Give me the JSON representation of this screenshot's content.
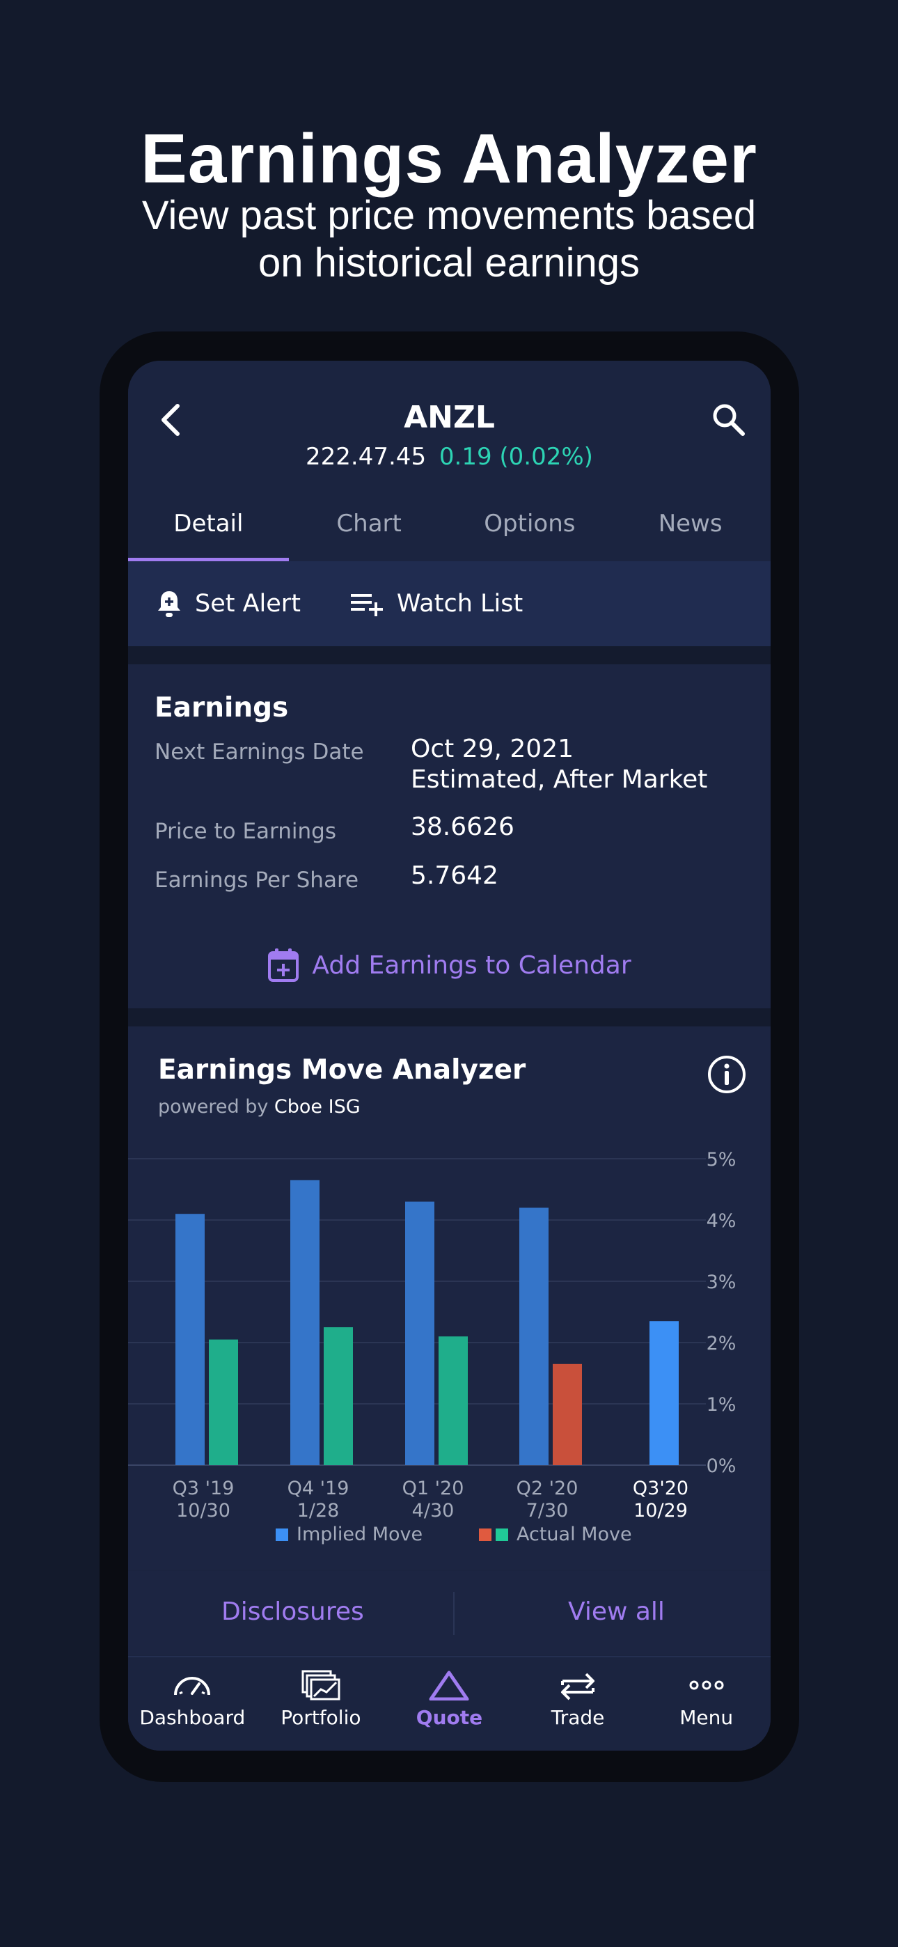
{
  "hero": {
    "title": "Earnings Analyzer",
    "subtitle_line1": "View past price movements based",
    "subtitle_line2": "on historical earnings"
  },
  "header": {
    "ticker": "ANZL",
    "price": "222.47.45",
    "change": "0.19 (0.02%)",
    "back_icon": "chevron-left-icon",
    "search_icon": "search-icon"
  },
  "tabs": [
    {
      "label": "Detail",
      "active": true
    },
    {
      "label": "Chart",
      "active": false
    },
    {
      "label": "Options",
      "active": false
    },
    {
      "label": "News",
      "active": false
    }
  ],
  "actions": {
    "set_alert": "Set Alert",
    "watch_list": "Watch List"
  },
  "earnings": {
    "title": "Earnings",
    "rows": [
      {
        "label": "Next Earnings Date",
        "value": "Oct 29, 2021",
        "value2": "Estimated, After Market"
      },
      {
        "label": "Price to Earnings",
        "value": "38.6626"
      },
      {
        "label": "Earnings Per Share",
        "value": "5.7642"
      }
    ],
    "calendar_link": "Add Earnings to Calendar"
  },
  "analyzer": {
    "title": "Earnings Move Analyzer",
    "powered_prefix": "powered by",
    "powered_by": "Cboe ISG"
  },
  "chart_data": {
    "type": "bar",
    "categories": [
      "Q3 '19\n10/30",
      "Q4 '19\n1/28",
      "Q1 '20\n4/30",
      "Q2 '20\n7/30",
      "Q3'20\n10/29"
    ],
    "category_line1": [
      "Q3 '19",
      "Q4 '19",
      "Q1 '20",
      "Q2 '20",
      "Q3'20"
    ],
    "category_line2": [
      "10/30",
      "1/28",
      "4/30",
      "7/30",
      "10/29"
    ],
    "series": [
      {
        "name": "Implied Move",
        "values": [
          4.1,
          4.65,
          4.3,
          4.2,
          2.35
        ]
      },
      {
        "name": "Actual Move",
        "values": [
          2.05,
          2.25,
          2.1,
          1.65,
          null
        ],
        "negative": [
          false,
          false,
          false,
          true,
          false
        ]
      }
    ],
    "yticks": [
      "5%",
      "4%",
      "3%",
      "2%",
      "1%",
      "0%"
    ],
    "ylim": [
      0,
      5
    ],
    "grid": true,
    "legend_position": "bottom",
    "colors": {
      "implied": "#3575c9",
      "implied_upcoming": "#3c90f5",
      "actual_up": "#1fae8b",
      "actual_down": "#c9503b"
    },
    "legend": {
      "implied": "Implied Move",
      "actual": "Actual Move"
    }
  },
  "footer": {
    "disclosures": "Disclosures",
    "view_all": "View all"
  },
  "tabbar": [
    {
      "label": "Dashboard",
      "icon": "speedometer-icon",
      "active": false
    },
    {
      "label": "Portfolio",
      "icon": "portfolio-icon",
      "active": false
    },
    {
      "label": "Quote",
      "icon": "triangle-icon",
      "active": true
    },
    {
      "label": "Trade",
      "icon": "swap-arrows-icon",
      "active": false
    },
    {
      "label": "Menu",
      "icon": "more-dots-icon",
      "active": false
    }
  ]
}
